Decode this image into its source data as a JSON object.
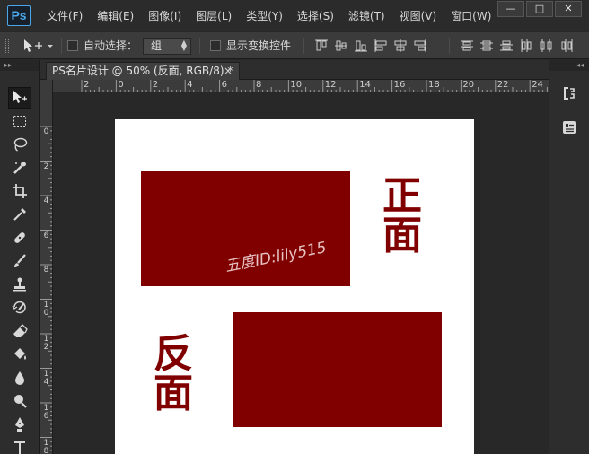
{
  "app": {
    "logo_text": "Ps"
  },
  "menubar": {
    "items": [
      "文件(F)",
      "编辑(E)",
      "图像(I)",
      "图层(L)",
      "类型(Y)",
      "选择(S)",
      "滤镜(T)",
      "视图(V)",
      "窗口(W)"
    ],
    "window_buttons": {
      "minimize": "—",
      "maximize": "□",
      "close": "✕"
    }
  },
  "options": {
    "tool_icon": "move-tool-icon",
    "auto_select_label": "自动选择：",
    "auto_select_checked": false,
    "auto_select_target": "组",
    "show_transform_label": "显示变换控件",
    "show_transform_checked": false
  },
  "document": {
    "tab_title": "PS名片设计 @ 50% (反面, RGB/8) *",
    "tab_close": "×",
    "ruler_h_labels": [
      "2",
      "0",
      "2",
      "4",
      "6",
      "8",
      "10",
      "12",
      "14",
      "16",
      "18",
      "20",
      "22",
      "24"
    ],
    "ruler_v_labels": [
      "0",
      "2",
      "4",
      "6",
      "8",
      "10",
      "12",
      "14",
      "16",
      "18"
    ],
    "canvas": {
      "front_label": "正面",
      "back_label": "反面",
      "watermark": "五度ID:lily515",
      "card_color": "#800000",
      "paper_color": "#ffffff"
    }
  },
  "left_tools": [
    "move-tool-icon",
    "marquee-tool-icon",
    "lasso-tool-icon",
    "quick-select-tool-icon",
    "crop-tool-icon",
    "eyedropper-tool-icon",
    "healing-brush-tool-icon",
    "brush-tool-icon",
    "clone-stamp-tool-icon",
    "history-brush-tool-icon",
    "eraser-tool-icon",
    "paint-bucket-tool-icon",
    "blur-tool-icon",
    "dodge-tool-icon",
    "pen-tool-icon",
    "type-tool-icon"
  ],
  "right_dock": [
    "history-panel-icon",
    "properties-panel-icon"
  ]
}
